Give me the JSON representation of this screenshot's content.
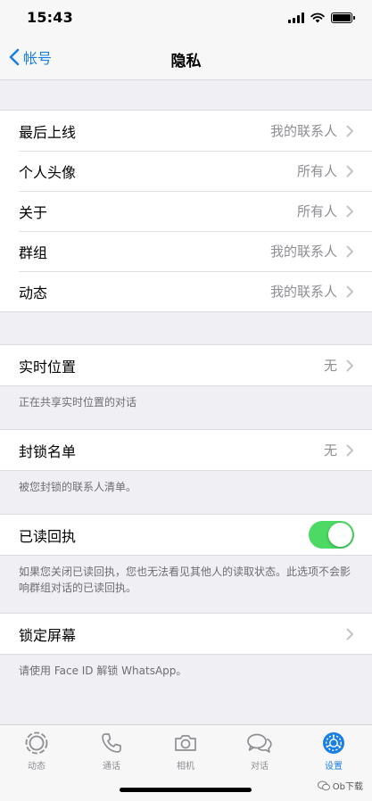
{
  "status": {
    "time": "15:43"
  },
  "nav": {
    "back_label": "帐号",
    "title": "隐私"
  },
  "group1": [
    {
      "label": "最后上线",
      "value": "我的联系人"
    },
    {
      "label": "个人头像",
      "value": "所有人"
    },
    {
      "label": "关于",
      "value": "所有人"
    },
    {
      "label": "群组",
      "value": "我的联系人"
    },
    {
      "label": "动态",
      "value": "我的联系人"
    }
  ],
  "live_location": {
    "label": "实时位置",
    "value": "无",
    "note": "正在共享实时位置的对话"
  },
  "blocked": {
    "label": "封锁名单",
    "value": "无",
    "note": "被您封锁的联系人清单。"
  },
  "read_receipts": {
    "label": "已读回执",
    "enabled": true,
    "note": "如果您关闭已读回执，您也无法看见其他人的读取状态。此选项不会影响群组对话的已读回执。"
  },
  "screen_lock": {
    "label": "锁定屏幕",
    "note": "请使用 Face ID 解锁 WhatsApp。"
  },
  "tabs": [
    {
      "label": "动态",
      "icon": "status-icon"
    },
    {
      "label": "通话",
      "icon": "phone-icon"
    },
    {
      "label": "相机",
      "icon": "camera-icon"
    },
    {
      "label": "对话",
      "icon": "chats-icon"
    },
    {
      "label": "设置",
      "icon": "settings-icon",
      "active": true
    }
  ],
  "watermark": "Ob下载",
  "colors": {
    "accent": "#1a7fe5",
    "toggle_on": "#4cd964",
    "background": "#efeff4"
  }
}
